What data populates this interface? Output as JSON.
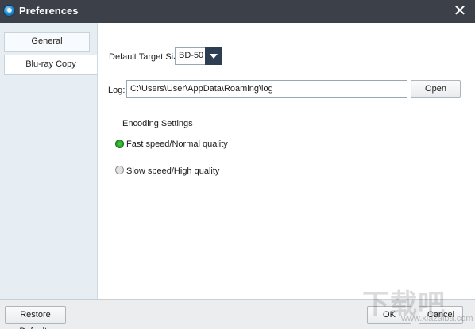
{
  "window": {
    "title": "Preferences",
    "app_icon": "globe-icon",
    "close_icon": "close-icon",
    "close_glyph": "✕"
  },
  "sidebar": {
    "items": [
      {
        "label": "General"
      },
      {
        "label": "Blu-ray Copy",
        "selected": true
      }
    ]
  },
  "settings": {
    "target_size_label": "Default Target Size:",
    "target_size_value": "BD-50",
    "log_label": "Log:",
    "log_path": "C:\\Users\\User\\AppData\\Roaming\\log",
    "open_label": "Open",
    "encoding_title": "Encoding Settings",
    "options": [
      {
        "label": "Fast speed/Normal quality",
        "checked": true
      },
      {
        "label": "Slow speed/High quality",
        "checked": false
      }
    ]
  },
  "footer": {
    "restore_label": "Restore Defaults",
    "ok_label": "OK",
    "cancel_label": "Cancel"
  },
  "watermark": {
    "text": "下载吧",
    "url": "www.xiazaiba.com"
  },
  "colors": {
    "titlebar": "#3c4049",
    "sidebar": "#e6eef4",
    "radio_checked": "#2aa82a",
    "dropdown_arrow": "#2d3e52"
  }
}
